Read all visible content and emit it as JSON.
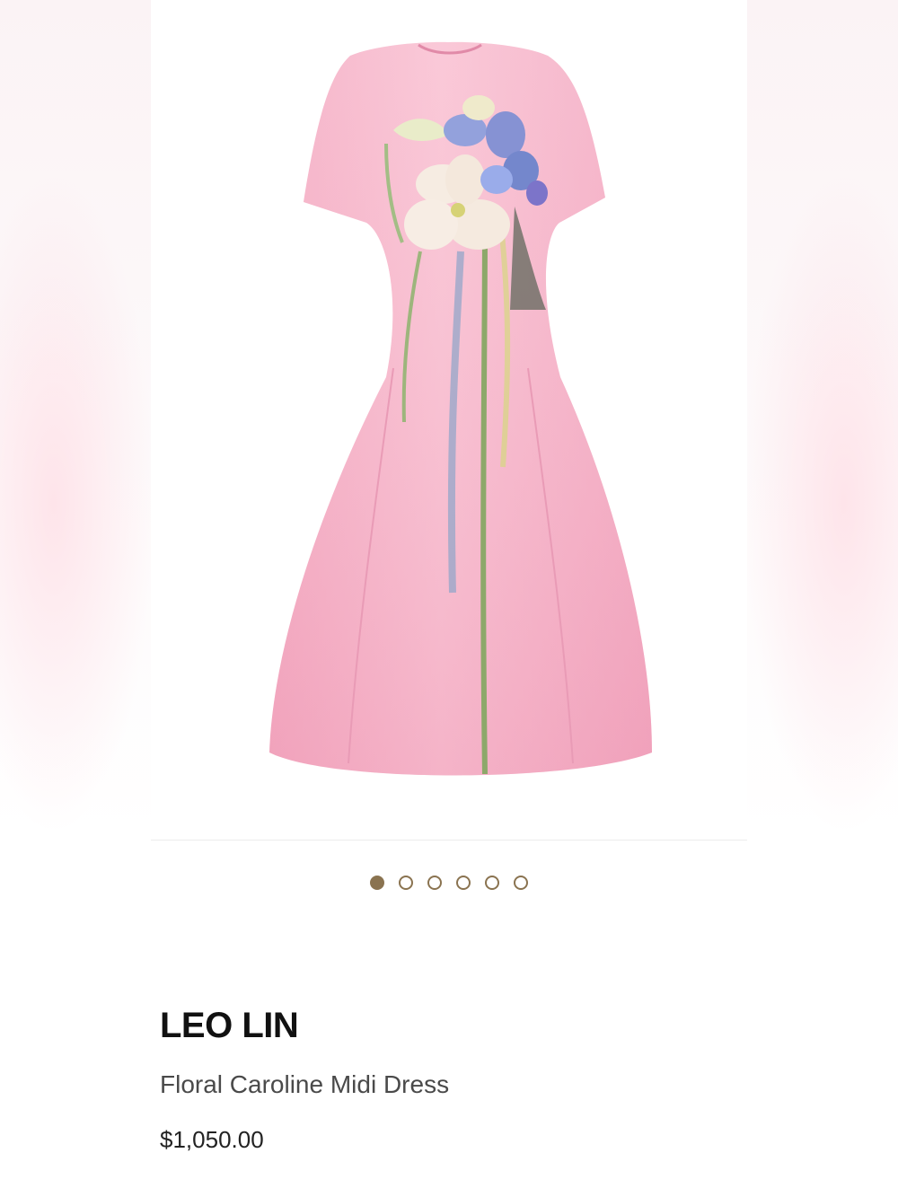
{
  "product": {
    "brand": "LEO LIN",
    "name": "Floral Caroline Midi Dress",
    "price": "$1,050.00"
  },
  "gallery": {
    "image_alt": "pink-floral-midi-dress-image",
    "image_count": 6,
    "active_index": 0
  },
  "colors": {
    "dress_pink": "#f7b3c9",
    "accent_gold": "#8a7350"
  }
}
